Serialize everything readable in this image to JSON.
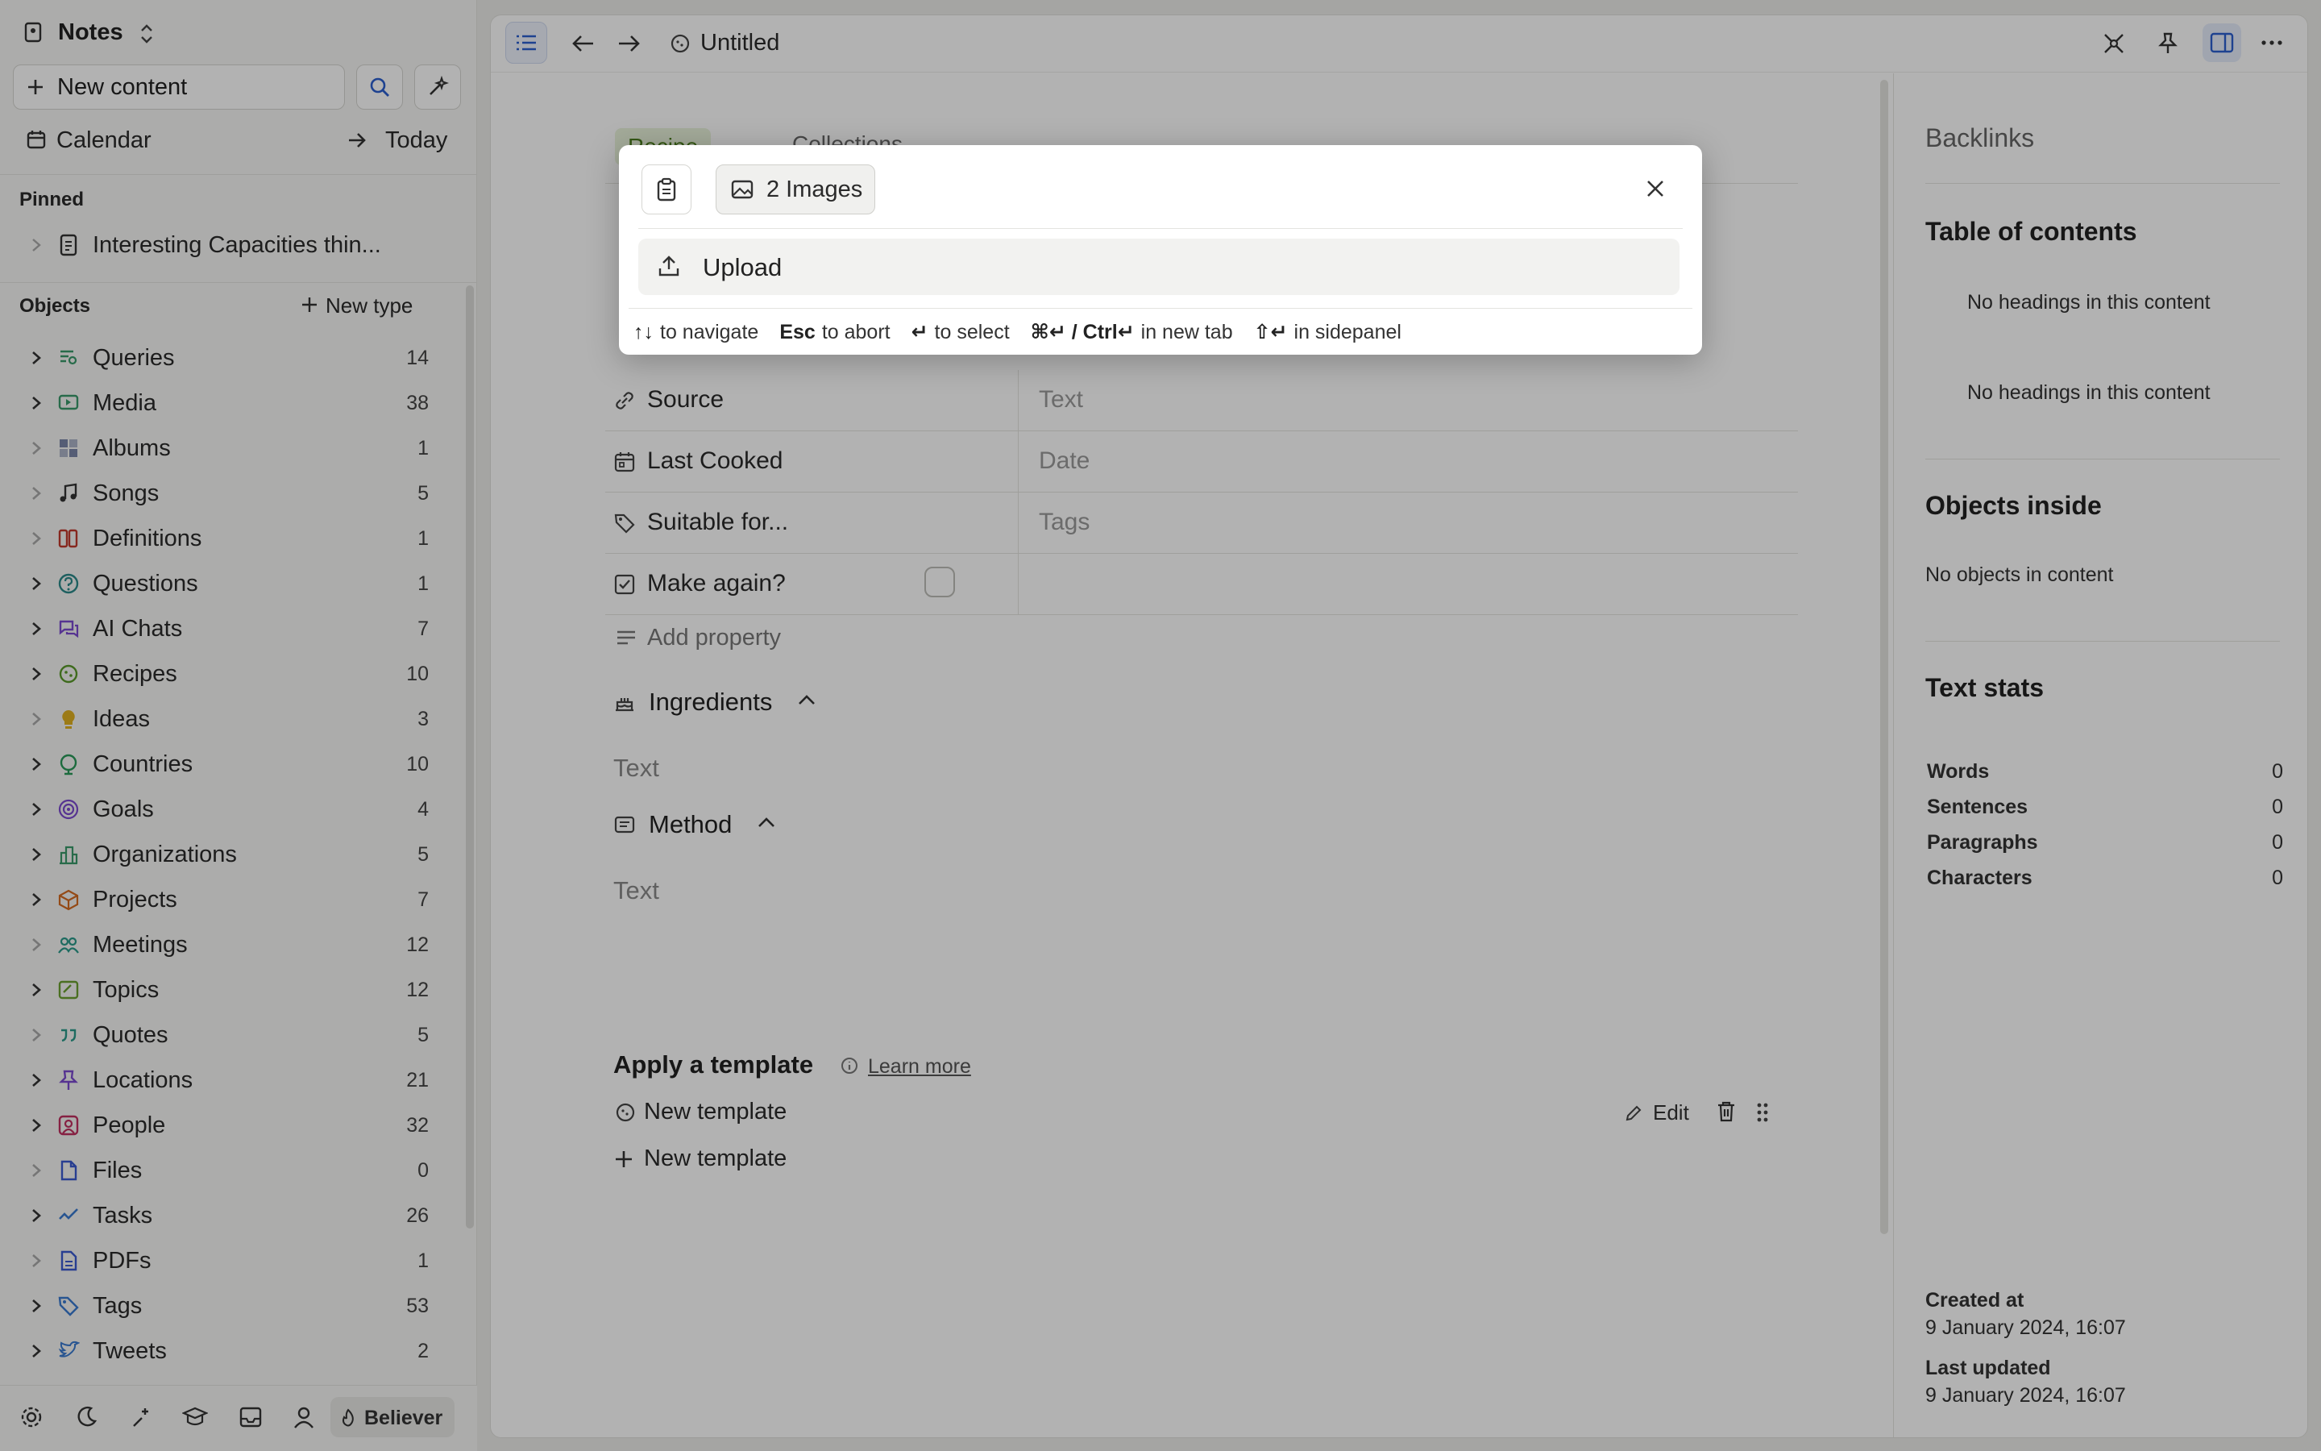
{
  "app": {
    "title": "Notes"
  },
  "sidebar": {
    "new_content": "New content",
    "calendar": "Calendar",
    "today": "Today",
    "pinned_header": "Pinned",
    "pinned_item": "Interesting Capacities thin...",
    "objects_header": "Objects",
    "new_type": "New type",
    "objects": [
      {
        "label": "Queries",
        "count": "14",
        "icon": "queries-icon",
        "color": "#3a9a6a"
      },
      {
        "label": "Media",
        "count": "38",
        "icon": "media-icon",
        "color": "#3a9a6a"
      },
      {
        "label": "Albums",
        "count": "1",
        "icon": "albums-icon",
        "color": "#7a86a8"
      },
      {
        "label": "Songs",
        "count": "5",
        "icon": "music-note-icon",
        "color": "#333333"
      },
      {
        "label": "Definitions",
        "count": "1",
        "icon": "definitions-icon",
        "color": "#c0392b"
      },
      {
        "label": "Questions",
        "count": "1",
        "icon": "question-icon",
        "color": "#2c8a8a"
      },
      {
        "label": "AI Chats",
        "count": "7",
        "icon": "chat-icon",
        "color": "#7c4ad0"
      },
      {
        "label": "Recipes",
        "count": "10",
        "icon": "recipe-icon",
        "color": "#5a9a2a"
      },
      {
        "label": "Ideas",
        "count": "3",
        "icon": "lightbulb-icon",
        "color": "#e0b020"
      },
      {
        "label": "Countries",
        "count": "10",
        "icon": "globe-icon",
        "color": "#2a9a5a"
      },
      {
        "label": "Goals",
        "count": "4",
        "icon": "target-icon",
        "color": "#7c4ad0"
      },
      {
        "label": "Organizations",
        "count": "5",
        "icon": "building-icon",
        "color": "#3a9a6a"
      },
      {
        "label": "Projects",
        "count": "7",
        "icon": "box-icon",
        "color": "#d46a20"
      },
      {
        "label": "Meetings",
        "count": "12",
        "icon": "people-icon",
        "color": "#2a9a8a"
      },
      {
        "label": "Topics",
        "count": "12",
        "icon": "topic-icon",
        "color": "#6aa030"
      },
      {
        "label": "Quotes",
        "count": "5",
        "icon": "quote-icon",
        "color": "#2a9a8a"
      },
      {
        "label": "Locations",
        "count": "21",
        "icon": "pin-icon",
        "color": "#7c4ad0"
      },
      {
        "label": "People",
        "count": "32",
        "icon": "person-icon",
        "color": "#c03060"
      },
      {
        "label": "Files",
        "count": "0",
        "icon": "file-icon",
        "color": "#3a5ad0"
      },
      {
        "label": "Tasks",
        "count": "26",
        "icon": "tasks-icon",
        "color": "#3a7ad0"
      },
      {
        "label": "PDFs",
        "count": "1",
        "icon": "pdf-icon",
        "color": "#3a5ad0"
      },
      {
        "label": "Tags",
        "count": "53",
        "icon": "tag-icon",
        "color": "#3a7ad0"
      },
      {
        "label": "Tweets",
        "count": "2",
        "icon": "bird-icon",
        "color": "#3a7ad0"
      }
    ],
    "footer_badge": "Believer"
  },
  "toolbar": {
    "doc_title": "Untitled"
  },
  "doc": {
    "type_chip": "Recipe",
    "collections": "Collections",
    "properties": [
      {
        "name": "Source",
        "value": "Text",
        "icon": "link-icon"
      },
      {
        "name": "Last Cooked",
        "value": "Date",
        "icon": "calendar-icon"
      },
      {
        "name": "Suitable for...",
        "value": "Tags",
        "icon": "tag-icon"
      },
      {
        "name": "Make again?",
        "value": "",
        "icon": "checkbox-icon"
      }
    ],
    "add_property": "Add property",
    "sections": [
      {
        "title": "Ingredients",
        "placeholder": "Text",
        "icon": "cake-icon"
      },
      {
        "title": "Method",
        "placeholder": "Text",
        "icon": "list-icon"
      }
    ],
    "template_header": "Apply a template",
    "learn_more": "Learn more",
    "template_item": "New template",
    "template_edit": "Edit",
    "new_template": "New template"
  },
  "right_panel": {
    "backlinks": "Backlinks",
    "toc": "Table of contents",
    "toc_empty_1": "No headings in this content",
    "toc_empty_2": "No headings in this content",
    "objects_inside": "Objects inside",
    "objects_empty": "No objects in content",
    "text_stats": "Text stats",
    "stats": [
      {
        "label": "Words",
        "value": "0"
      },
      {
        "label": "Sentences",
        "value": "0"
      },
      {
        "label": "Paragraphs",
        "value": "0"
      },
      {
        "label": "Characters",
        "value": "0"
      }
    ],
    "created_label": "Created at",
    "created_value": "9 January 2024, 16:07",
    "updated_label": "Last updated",
    "updated_value": "9 January 2024, 16:07"
  },
  "dialog": {
    "images_chip": "2 Images",
    "upload": "Upload",
    "hints": [
      {
        "key": "↑↓",
        "text": "to navigate"
      },
      {
        "key": "Esc",
        "text": "to abort"
      },
      {
        "key": "↵",
        "text": "to select"
      },
      {
        "key": "⌘↵ / Ctrl↵",
        "text": "in new tab"
      },
      {
        "key": "⇧↵",
        "text": "in sidepanel"
      }
    ]
  }
}
